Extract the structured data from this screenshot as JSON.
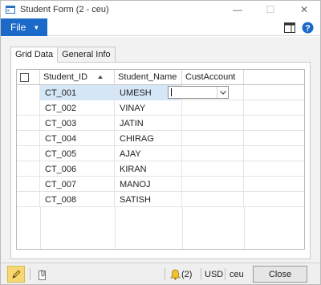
{
  "window": {
    "title": "Student Form (2 - ceu)",
    "controls": {
      "minimize": "—",
      "maximize": "☐",
      "close": "✕"
    }
  },
  "ribbon": {
    "file_label": "File",
    "icons": [
      "layout-icon",
      "help-icon"
    ]
  },
  "tabs": [
    {
      "label": "Grid Data",
      "active": true
    },
    {
      "label": "General Info",
      "active": false
    }
  ],
  "grid": {
    "columns": [
      {
        "label": "Student_ID",
        "sorted": "ascending"
      },
      {
        "label": "Student_Name"
      },
      {
        "label": "CustAccount"
      }
    ],
    "rows": [
      {
        "id": "CT_001",
        "name": "UMESH",
        "cust": ""
      },
      {
        "id": "CT_002",
        "name": "VINAY",
        "cust": ""
      },
      {
        "id": "CT_003",
        "name": "JATIN",
        "cust": ""
      },
      {
        "id": "CT_004",
        "name": "CHIRAG",
        "cust": ""
      },
      {
        "id": "CT_005",
        "name": "AJAY",
        "cust": ""
      },
      {
        "id": "CT_006",
        "name": "KIRAN",
        "cust": ""
      },
      {
        "id": "CT_007",
        "name": "MANOJ",
        "cust": ""
      },
      {
        "id": "CT_008",
        "name": "SATISH",
        "cust": ""
      }
    ]
  },
  "status": {
    "notifications": "(2)",
    "currency": "USD",
    "company": "ceu",
    "close_label": "Close"
  },
  "colors": {
    "accent": "#1b6ac9",
    "selected_row": "#d5e6f7"
  }
}
